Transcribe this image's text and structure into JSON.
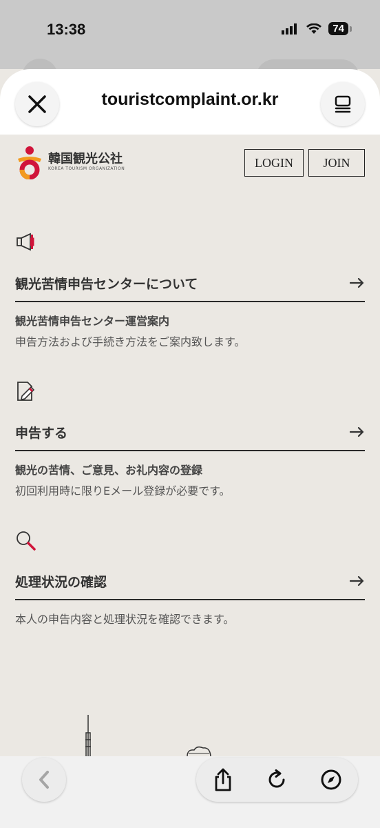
{
  "status_bar": {
    "time": "13:38",
    "battery": "74"
  },
  "browser": {
    "title": "touristcomplaint.or.kr"
  },
  "site": {
    "logo_korean": "韓国観光公社",
    "logo_english": "KOREA TOURISM ORGANIZATION",
    "login_label": "LOGIN",
    "join_label": "JOIN"
  },
  "sections": [
    {
      "icon": "megaphone-icon",
      "title": "観光苦情申告センターについて",
      "subtitle": "観光苦情申告センター運営案内",
      "description": "申告方法および手続き方法をご案内致します。"
    },
    {
      "icon": "edit-document-icon",
      "title": "申告する",
      "subtitle": "観光の苦情、ご意見、お礼内容の登録",
      "description": "初回利用時に限りEメール登録が必要です。"
    },
    {
      "icon": "search-icon",
      "title": "処理状況の確認",
      "subtitle": "",
      "description": "本人の申告内容と処理状況を確認できます。"
    }
  ],
  "colors": {
    "page_background": "#ebe8e3",
    "logo_red": "#d0143a",
    "logo_orange": "#f29a1f"
  }
}
